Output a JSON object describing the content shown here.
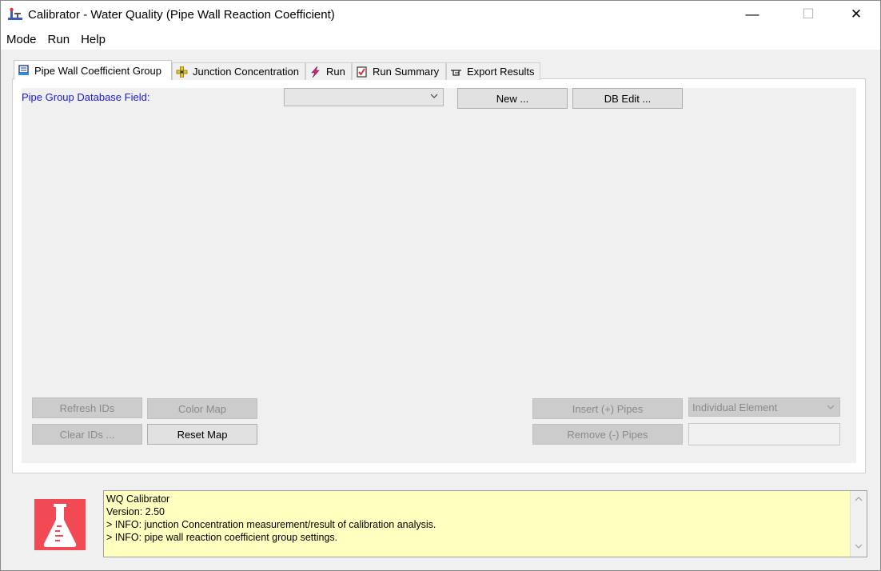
{
  "window": {
    "title": "Calibrator - Water Quality (Pipe Wall Reaction Coefficient)",
    "minimize_glyph": "—",
    "maximize_glyph": "☐",
    "close_glyph": "✕"
  },
  "menu": [
    "Mode",
    "Run",
    "Help"
  ],
  "tabs": [
    {
      "label": "Pipe Wall Coefficient Group",
      "icon": "pipe-group-icon",
      "active": true
    },
    {
      "label": "Junction Concentration",
      "icon": "junction-icon",
      "active": false
    },
    {
      "label": "Run",
      "icon": "lightning-icon",
      "active": false
    },
    {
      "label": "Run Summary",
      "icon": "checklist-icon",
      "active": false
    },
    {
      "label": "Export Results",
      "icon": "pointing-hand-icon",
      "active": false
    }
  ],
  "pipe_group": {
    "field_label": "Pipe Group Database Field:",
    "field_value": "",
    "new_button": "New ...",
    "db_edit_button": "DB Edit ..."
  },
  "actions": {
    "refresh_ids": "Refresh IDs",
    "clear_ids": "Clear IDs ...",
    "color_map": "Color Map",
    "reset_map": "Reset Map",
    "insert_pipes": "Insert (+) Pipes",
    "remove_pipes": "Remove (-) Pipes",
    "selection_mode": "Individual Element",
    "selection_value": ""
  },
  "log": {
    "lines": [
      "WQ Calibrator",
      "Version: 2.50",
      "> INFO: junction Concentration measurement/result of calibration analysis.",
      "> INFO: pipe wall reaction coefficient group settings."
    ]
  },
  "colors": {
    "log_background": "#ffffc0",
    "label_blue": "#1a1ad8",
    "logo_red": "#f24a55"
  }
}
